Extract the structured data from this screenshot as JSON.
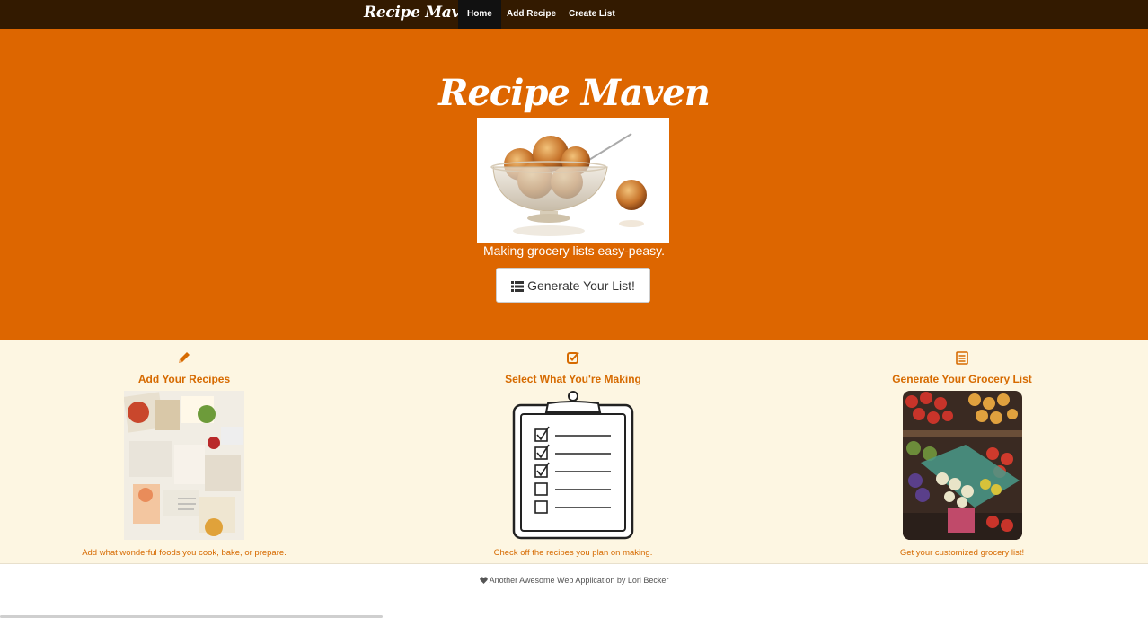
{
  "nav": {
    "brand": "Recipe Maven",
    "items": [
      {
        "label": "Home",
        "active": true
      },
      {
        "label": "Add Recipe",
        "active": false
      },
      {
        "label": "Create List",
        "active": false
      }
    ]
  },
  "hero": {
    "title": "Recipe Maven",
    "image_icon": "glazed-fruit-bowl-photo",
    "tagline": "Making grocery lists easy-peasy.",
    "button_label": "Generate Your List!",
    "button_icon": "list-icon"
  },
  "features": [
    {
      "icon": "pencil-icon",
      "title": "Add Your Recipes",
      "image": "vintage-recipe-collage-photo",
      "description": "Add what wonderful foods you cook, bake, or prepare."
    },
    {
      "icon": "checkbox-icon",
      "title": "Select What You're Making",
      "image": "clipboard-checklist-drawing",
      "description": "Check off the recipes you plan on making."
    },
    {
      "icon": "list-alt-icon",
      "title": "Generate Your Grocery List",
      "image": "grocery-produce-photo",
      "description": "Get your customized grocery list!"
    }
  ],
  "footer": {
    "icon": "heart-icon",
    "text": "Another Awesome Web Application by Lori Becker"
  },
  "colors": {
    "navbar": "#331a00",
    "hero": "#dd6600",
    "features_bg": "#fdf6e2",
    "accent": "#d66a00"
  }
}
